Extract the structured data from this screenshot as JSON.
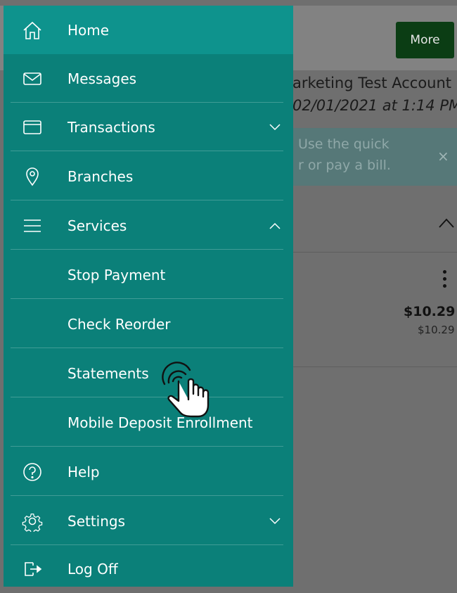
{
  "header": {
    "more_label": "More"
  },
  "account": {
    "name": "arketing Test Account",
    "date": "02/01/2021 at 1:14 PM"
  },
  "banner": {
    "line1": "Use the quick",
    "line2": "r or pay a bill.",
    "close": "×"
  },
  "transaction": {
    "amount": "$10.29",
    "balance": "$10.29"
  },
  "menu": {
    "items": [
      {
        "label": "Home",
        "icon": "home-icon"
      },
      {
        "label": "Messages",
        "icon": "envelope-icon"
      },
      {
        "label": "Transactions",
        "icon": "card-icon",
        "expandable": true,
        "expanded": false
      },
      {
        "label": "Branches",
        "icon": "location-pin-icon"
      },
      {
        "label": "Services",
        "icon": "menu-lines-icon",
        "expandable": true,
        "expanded": true
      },
      {
        "label": "Stop Payment"
      },
      {
        "label": "Check Reorder"
      },
      {
        "label": "Statements"
      },
      {
        "label": "Mobile Deposit Enrollment"
      },
      {
        "label": "Help",
        "icon": "help-circle-icon"
      },
      {
        "label": "Settings",
        "icon": "gear-icon",
        "expandable": true,
        "expanded": false
      },
      {
        "label": "Log Off",
        "icon": "logout-icon"
      }
    ]
  },
  "colors": {
    "drawer": "#0b8079",
    "drawer_active": "#0e938d",
    "more_button": "#0b3d14",
    "overlay": "#6f6f6f"
  }
}
